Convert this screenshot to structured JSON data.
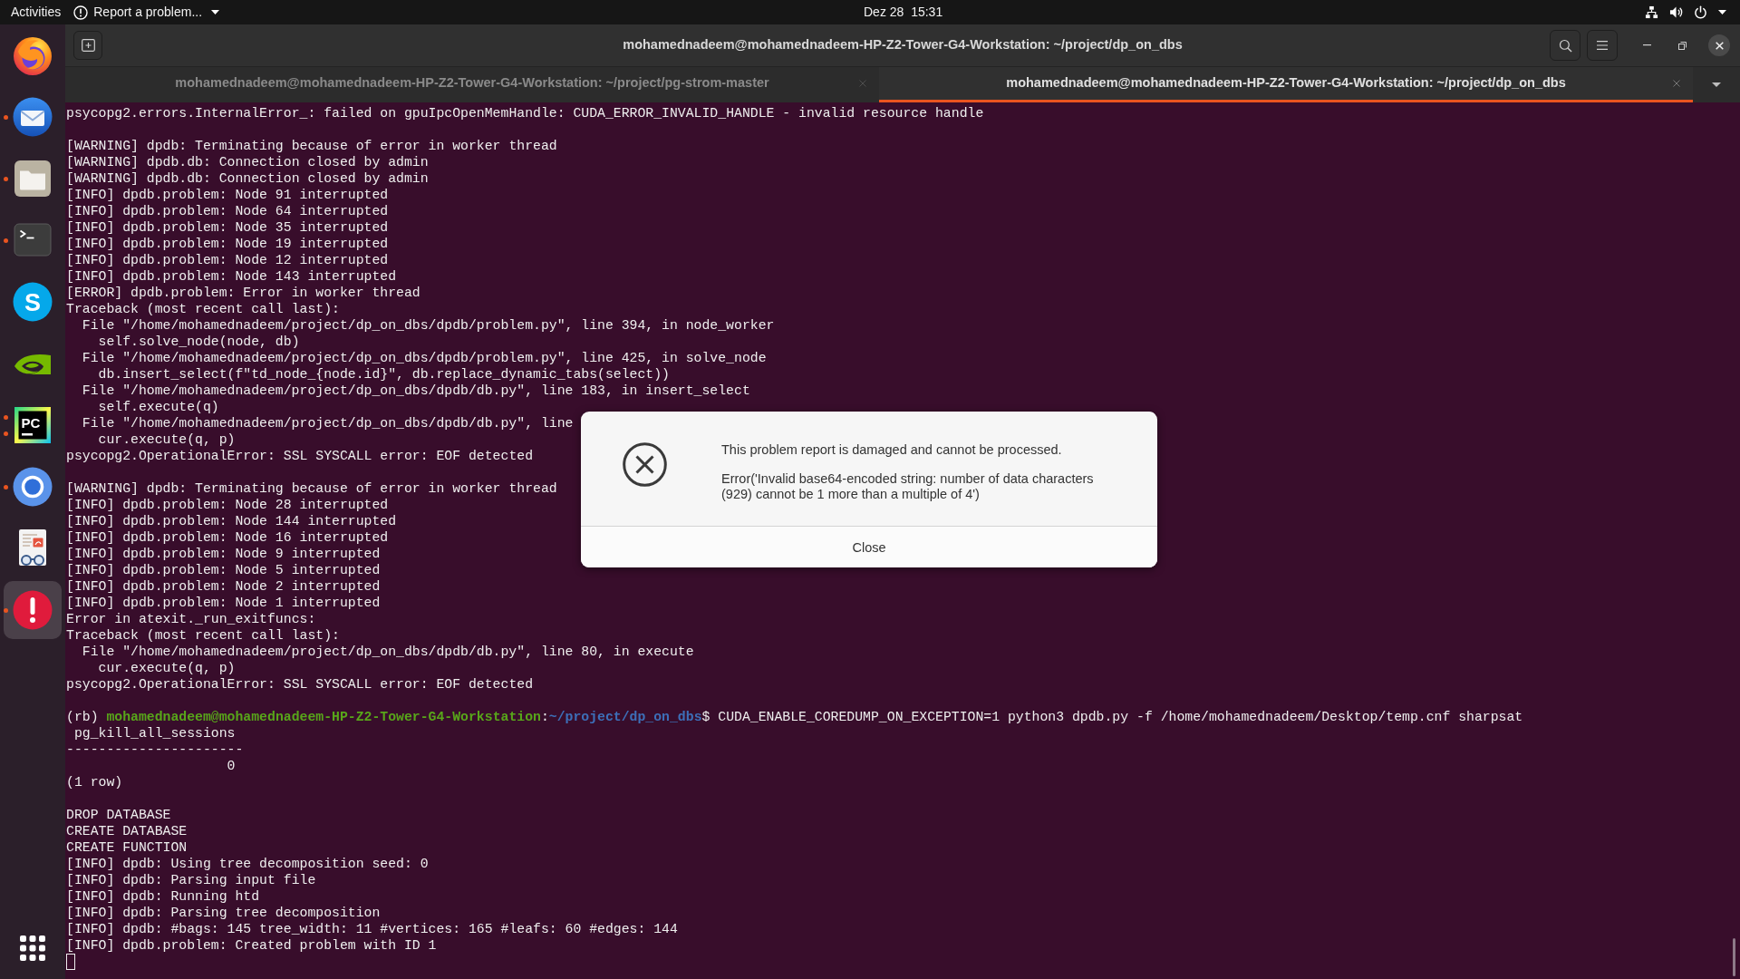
{
  "top_bar": {
    "activities": "Activities",
    "app_menu": "Report a problem...",
    "clock": "Dez 28  15:31"
  },
  "dock": {
    "items": [
      {
        "kind": "globe",
        "running": false,
        "multiple_windows": false,
        "selected": false
      },
      {
        "kind": "envelope",
        "running": true,
        "multiple_windows": false,
        "selected": false
      },
      {
        "kind": "folder",
        "running": true,
        "multiple_windows": false,
        "selected": false
      },
      {
        "kind": "terminal",
        "running": true,
        "multiple_windows": false,
        "selected": false
      },
      {
        "kind": "letter-circle",
        "glyph": "S",
        "running": false,
        "multiple_windows": false,
        "selected": false
      },
      {
        "kind": "eye",
        "running": false,
        "multiple_windows": false,
        "selected": false
      },
      {
        "kind": "letter-square",
        "glyph": "PC",
        "running": true,
        "multiple_windows": true,
        "selected": false
      },
      {
        "kind": "ring",
        "running": true,
        "multiple_windows": false,
        "selected": false
      },
      {
        "kind": "document",
        "running": false,
        "multiple_windows": false,
        "selected": false
      },
      {
        "kind": "alert",
        "running": true,
        "multiple_windows": false,
        "selected": true
      }
    ]
  },
  "terminal": {
    "title": "mohamednadeem@mohamednadeem-HP-Z2-Tower-G4-Workstation: ~/project/dp_on_dbs",
    "tabs": [
      {
        "label": "mohamednadeem@mohamednadeem-HP-Z2-Tower-G4-Workstation: ~/project/pg-strom-master",
        "selected": false
      },
      {
        "label": "mohamednadeem@mohamednadeem-HP-Z2-Tower-G4-Workstation: ~/project/dp_on_dbs",
        "selected": true
      }
    ],
    "blocks": [
      {
        "lines": [
          "psycopg2.errors.InternalError_: failed on gpuIpcOpenMemHandle: CUDA_ERROR_INVALID_HANDLE - invalid resource handle"
        ]
      },
      {
        "lines": [
          "[WARNING] dpdb: Terminating because of error in worker thread",
          "[WARNING] dpdb.db: Connection closed by admin",
          "[WARNING] dpdb.db: Connection closed by admin",
          "[INFO] dpdb.problem: Node 91 interrupted",
          "[INFO] dpdb.problem: Node 64 interrupted",
          "[INFO] dpdb.problem: Node 35 interrupted",
          "[INFO] dpdb.problem: Node 19 interrupted",
          "[INFO] dpdb.problem: Node 12 interrupted",
          "[INFO] dpdb.problem: Node 143 interrupted",
          "[ERROR] dpdb.problem: Error in worker thread",
          "Traceback (most recent call last):",
          "  File \"/home/mohamednadeem/project/dp_on_dbs/dpdb/problem.py\", line 394, in node_worker",
          "    self.solve_node(node, db)",
          "  File \"/home/mohamednadeem/project/dp_on_dbs/dpdb/problem.py\", line 425, in solve_node",
          "    db.insert_select(f\"td_node_{node.id}\", db.replace_dynamic_tabs(select))",
          "  File \"/home/mohamednadeem/project/dp_on_dbs/dpdb/db.py\", line 183, in insert_select",
          "    self.execute(q)",
          "  File \"/home/mohamednadeem/project/dp_on_dbs/dpdb/db.py\", line",
          "    cur.execute(q, p)",
          "psycopg2.OperationalError: SSL SYSCALL error: EOF detected"
        ]
      },
      {
        "lines": [
          "[WARNING] dpdb: Terminating because of error in worker thread",
          "[INFO] dpdb.problem: Node 28 interrupted",
          "[INFO] dpdb.problem: Node 144 interrupted",
          "[INFO] dpdb.problem: Node 16 interrupted",
          "[INFO] dpdb.problem: Node 9 interrupted",
          "[INFO] dpdb.problem: Node 5 interrupted",
          "[INFO] dpdb.problem: Node 2 interrupted",
          "[INFO] dpdb.problem: Node 1 interrupted",
          "Error in atexit._run_exitfuncs:",
          "Traceback (most recent call last):",
          "  File \"/home/mohamednadeem/project/dp_on_dbs/dpdb/db.py\", line 80, in execute",
          "    cur.execute(q, p)",
          "psycopg2.OperationalError: SSL SYSCALL error: EOF detected"
        ]
      },
      {
        "prompt": [
          {
            "kind": "env",
            "text": "(rb) "
          },
          {
            "kind": "user",
            "text": "mohamednadeem@mohamednadeem-HP-Z2-Tower-G4-Workstation"
          },
          {
            "kind": "plain",
            "text": ":"
          },
          {
            "kind": "path",
            "text": "~/project/dp_on_dbs"
          },
          {
            "kind": "plain",
            "text": "$ CUDA_ENABLE_COREDUMP_ON_EXCEPTION=1 python3 dpdb.py -f /home/mohamednadeem/Desktop/temp.cnf sharpsat"
          }
        ],
        "lines": [
          " pg_kill_all_sessions",
          "----------------------",
          "                    0",
          "(1 row)"
        ]
      },
      {
        "lines": [
          "DROP DATABASE",
          "CREATE DATABASE",
          "CREATE FUNCTION",
          "[INFO] dpdb: Using tree decomposition seed: 0",
          "[INFO] dpdb: Parsing input file",
          "[INFO] dpdb: Running htd",
          "[INFO] dpdb: Parsing tree decomposition",
          "[INFO] dpdb: #bags: 145 tree_width: 11 #vertices: 165 #leafs: 60 #edges: 144",
          "[INFO] dpdb.problem: Created problem with ID 1"
        ]
      }
    ]
  },
  "dialog": {
    "message": "This problem report is damaged and cannot be processed.",
    "error": "Error('Invalid base64-encoded string: number of data characters (929) cannot be 1 more than a multiple of 4')",
    "button": "Close"
  }
}
